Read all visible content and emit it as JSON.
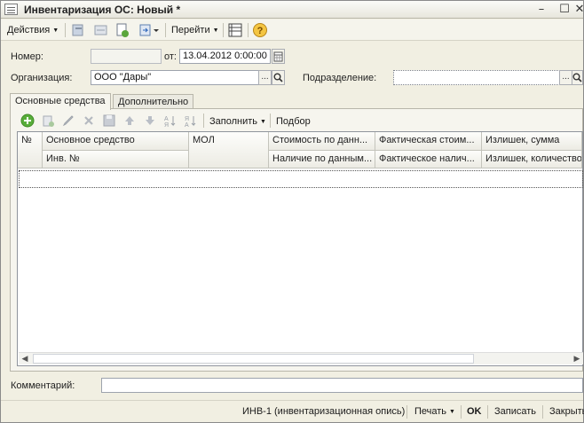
{
  "window": {
    "title": "Инвентаризация ОС: Новый *"
  },
  "toolbar": {
    "actions_label": "Действия",
    "goto_label": "Перейти"
  },
  "form": {
    "number_label": "Номер:",
    "number_value": "",
    "date_label": "от:",
    "date_value": "13.04.2012  0:00:00",
    "org_label": "Организация:",
    "org_value": "ООО \"Дары\"",
    "dept_label": "Подразделение:",
    "dept_value": "",
    "ellipsis": "...",
    "search_glyph": "Q"
  },
  "tabs": [
    {
      "label": "Основные средства",
      "active": true
    },
    {
      "label": "Дополнительно",
      "active": false
    }
  ],
  "grid_toolbar": {
    "fill_label": "Заполнить",
    "select_label": "Подбор"
  },
  "table": {
    "headers_top": [
      "№",
      "Основное средство",
      "МОЛ",
      "Стоимость по данн...",
      "Фактическая стоим...",
      "Излишек, сумма"
    ],
    "headers_bottom": [
      "Инв. №",
      "Наличие по данным...",
      "Фактическое налич...",
      "Излишек, количество"
    ],
    "rows": []
  },
  "comment": {
    "label": "Комментарий:",
    "value": ""
  },
  "statusbar": {
    "inv_label": "ИНВ-1 (инвентаризационная опись)",
    "print_label": "Печать",
    "ok_label": "OK",
    "save_label": "Записать",
    "close_label": "Закрыть"
  }
}
